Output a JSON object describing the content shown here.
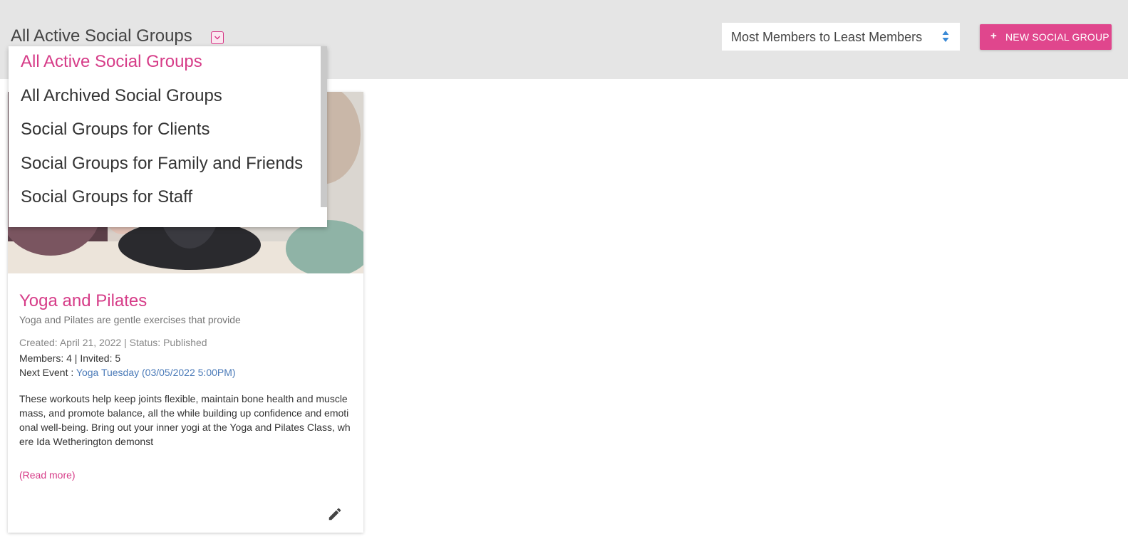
{
  "header": {
    "filter_title": "All Active Social Groups",
    "sort_label": "Most Members to Least Members",
    "new_button_plus": "+",
    "new_button_label": "NEW SOCIAL GROUP"
  },
  "dropdown": {
    "items": [
      {
        "label": "All Active Social Groups",
        "selected": true
      },
      {
        "label": "All Archived Social Groups"
      },
      {
        "label": "Social Groups for Clients"
      },
      {
        "label": "Social Groups for Family and Friends"
      },
      {
        "label": "Social Groups for Staff"
      }
    ]
  },
  "card": {
    "title": "Yoga and Pilates",
    "subtitle": "Yoga and Pilates are gentle exercises that provide",
    "created": "Created: April 21, 2022 | Status: Published",
    "members": "Members: 4 | Invited: 5",
    "next_event_label": "Next Event : ",
    "next_event_link": "Yoga Tuesday (03/05/2022 5:00PM)",
    "description": "These workouts help keep joints flexible, maintain bone health and muscle mass, and promote balance, all the while building up confidence and emotional well-being. Bring out your inner yogi at the Yoga and Pilates Class, where Ida Wetherington demonst",
    "read_more": "(Read more)"
  },
  "colors": {
    "accent": "#e0468d",
    "link": "#4a7ab8",
    "topbar": "#e5e5e5"
  },
  "icons": {
    "filter_toggle": "chevron-down-icon",
    "sort": "sort-arrows-icon",
    "edit": "pencil-icon"
  }
}
